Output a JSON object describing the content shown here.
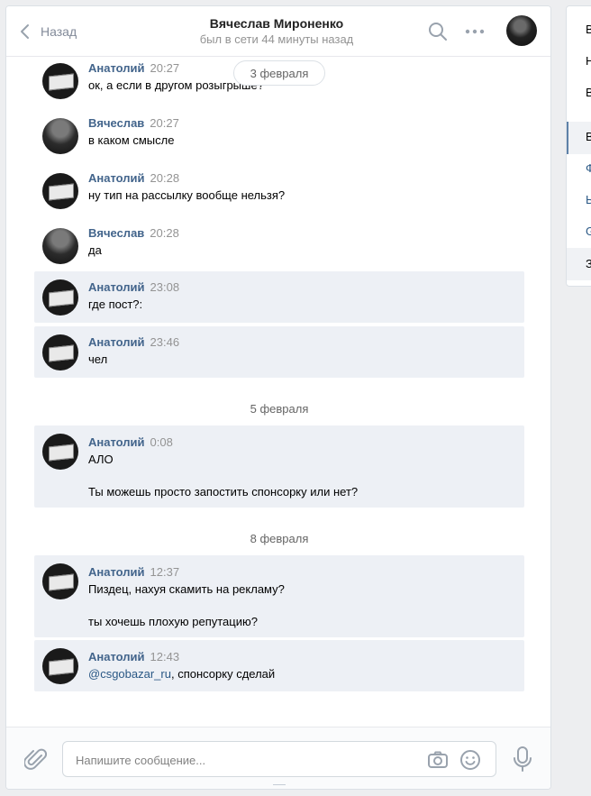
{
  "header": {
    "back_label": "Назад",
    "title": "Вячеслав Мироненко",
    "status": "был в сети 44 минуты назад"
  },
  "floating_date": "3 февраля",
  "messages": [
    {
      "author": "Анатолий",
      "time": "20:27",
      "text": "ок, а если в другом розыгрыше?"
    },
    {
      "author": "Вячеслав",
      "time": "20:27",
      "text": "в каком смысле"
    },
    {
      "author": "Анатолий",
      "time": "20:28",
      "text": "ну тип на рассылку вообще нельзя?"
    },
    {
      "author": "Вячеслав",
      "time": "20:28",
      "text": "да"
    },
    {
      "author": "Анатолий",
      "time": "23:08",
      "text": "где пост?:"
    },
    {
      "author": "Анатолий",
      "time": "23:46",
      "text": "чел"
    },
    {
      "author": "Анатолий",
      "time": "0:08",
      "text": "АЛО\n\nТы можешь просто запостить спонсорку или нет?"
    },
    {
      "author": "Анатолий",
      "time": "12:37",
      "text": "Пиздец, нахуя скамить на рекламу?\n\nты хочешь плохую репутацию?"
    },
    {
      "author": "Анатолий",
      "time": "12:43",
      "mention": "@csgobazar_ru",
      "text": ", спонсорку сделай"
    }
  ],
  "date_separators": [
    "5 февраля",
    "8 февраля"
  ],
  "composer": {
    "placeholder": "Напишите сообщение..."
  },
  "right_menu": [
    "В",
    "Н",
    "В",
    "В",
    "Ф",
    "Ы",
    "G",
    "З"
  ],
  "icons": {
    "back": "chevron-left-icon",
    "search": "search-icon",
    "more": "more-dots-icon",
    "attach": "paperclip-icon",
    "camera": "camera-icon",
    "emoji": "smile-icon",
    "voice": "microphone-icon"
  },
  "colors": {
    "author": "#42648b",
    "unread_bg": "#edf0f5",
    "time": "#939393",
    "link": "#2a5885"
  }
}
